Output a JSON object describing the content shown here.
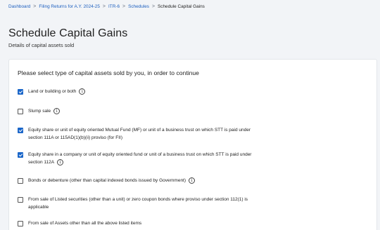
{
  "breadcrumb": {
    "items": [
      "Dashboard",
      "Filing Returns for A.Y. 2024-25",
      "ITR-6",
      "Schedules"
    ],
    "current": "Schedule Capital Gains",
    "separator": ">"
  },
  "page": {
    "title": "Schedule Capital Gains",
    "subtitle": "Details of capital assets sold"
  },
  "card": {
    "heading": "Please select type of capital assets sold by you, in order to continue",
    "options": [
      {
        "label": "Land or building or both",
        "checked": true,
        "info": true
      },
      {
        "label": "Slump sale",
        "checked": false,
        "info": true
      },
      {
        "label": "Equity share or unit of equity oriented Mutual Fund (MF) or unit of a business trust on which STT is paid under section 111A or 115AD(1)(b)(ii) proviso (for FII)",
        "checked": true,
        "info": false
      },
      {
        "label": "Equity share in a company or unit of equity oriented fund or unit of a business trust on which STT is paid under section 112A",
        "checked": true,
        "info": true
      },
      {
        "label": "Bonds or debenture (other than capital indexed bonds issued by Government)",
        "checked": false,
        "info": true
      },
      {
        "label": "From sale of Listed securities (other than a unit) or zero coupon bonds where proviso under section 112(1) is applicable",
        "checked": false,
        "info": false
      },
      {
        "label": "From sale of Assets other than all the above listed items",
        "checked": false,
        "info": false
      }
    ]
  },
  "icons": {
    "info": "info-circle-icon",
    "separator": "chevron-right-icon",
    "check": "checkmark-icon"
  },
  "colors": {
    "link": "#1d5fbf",
    "checkbox_checked": "#1a66c9",
    "background": "#f2f4f7"
  }
}
